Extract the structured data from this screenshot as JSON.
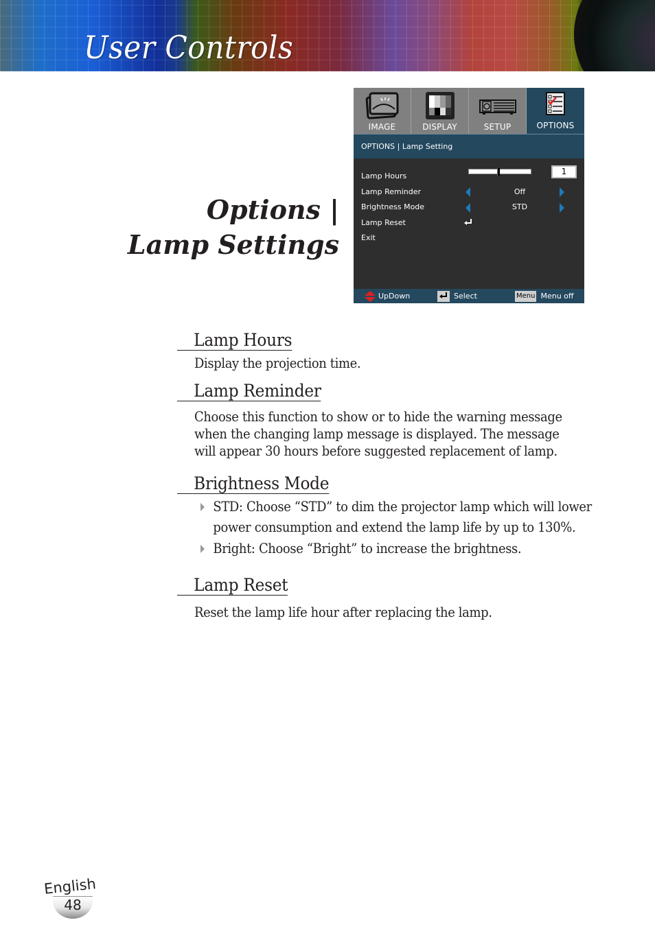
{
  "header": {
    "title": "User Controls"
  },
  "section_title": {
    "line1": "Options |",
    "line2": "Lamp Settings"
  },
  "osd": {
    "tabs": [
      {
        "label": "IMAGE",
        "icon": "image-icon",
        "active": false
      },
      {
        "label": "DISPLAY",
        "icon": "display-icon",
        "active": false
      },
      {
        "label": "SETUP",
        "icon": "projector-icon",
        "active": false
      },
      {
        "label": "OPTIONS",
        "icon": "checklist-icon",
        "active": true
      }
    ],
    "breadcrumb": "OPTIONS | Lamp Setting",
    "rows": [
      {
        "label": "Lamp Hours",
        "value": "1",
        "slider_fraction": 0.47
      },
      {
        "label": "Lamp Reminder",
        "value": "Off"
      },
      {
        "label": "Brightness Mode",
        "value": "STD"
      },
      {
        "label": "Lamp Reset",
        "icon": "enter-icon"
      },
      {
        "label": "Exit"
      }
    ],
    "footer": {
      "updown": "UpDown",
      "select": "Select",
      "menu_key": "Menu",
      "menu_off": "Menu off"
    },
    "colors": {
      "tab_bg": "#808080",
      "active_bg": "#24485e",
      "body_bg": "#2e2e2e",
      "arrow": "#1e7ab8"
    }
  },
  "sections": [
    {
      "heading": "Lamp Hours",
      "text": "Display the projection time."
    },
    {
      "heading": "Lamp Reminder",
      "text": "Choose this function to show or to hide the warning message when the changing lamp message is displayed. The message will appear 30 hours before suggested replacement of lamp."
    },
    {
      "heading": "Brightness Mode",
      "bullets": [
        "STD: Choose “STD” to dim the projector lamp which will lower power consumption and extend the lamp life by up to 130%.",
        "Bright: Choose “Bright” to increase the brightness."
      ]
    },
    {
      "heading": "Lamp Reset",
      "text": "Reset the lamp life hour after replacing the lamp."
    }
  ],
  "footer": {
    "language": "English",
    "page": "48"
  }
}
